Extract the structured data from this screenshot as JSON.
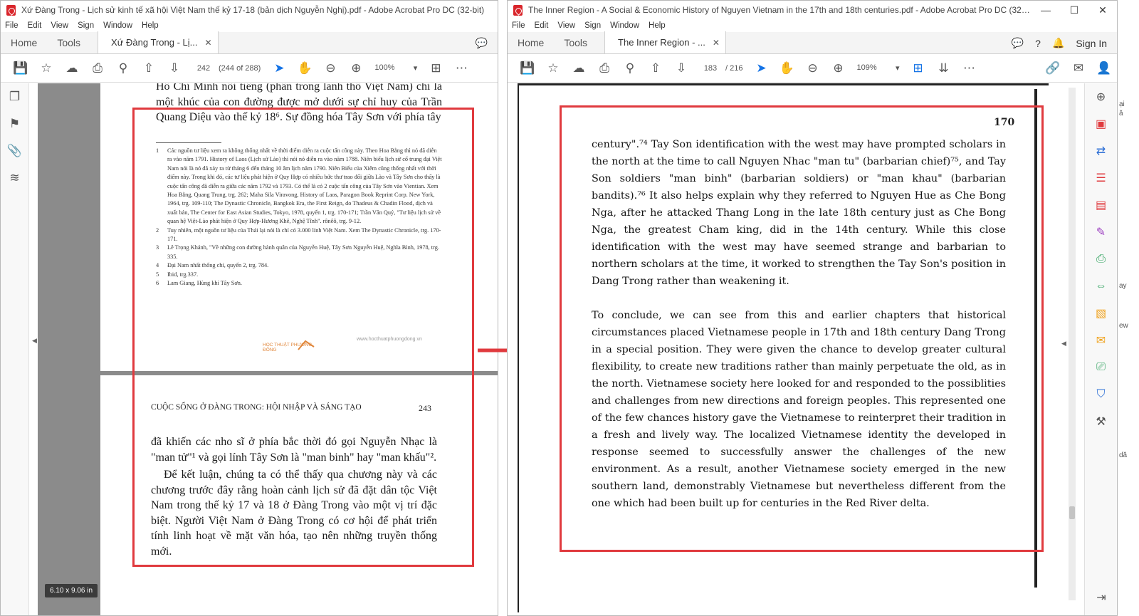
{
  "left": {
    "title": "Xứ Đàng Trong - Lịch sử kinh tế xã hội Việt Nam thế kỷ 17-18 (bản dịch Nguyễn Nghị).pdf - Adobe Acrobat Pro DC (32-bit)",
    "menu": [
      "File",
      "Edit",
      "View",
      "Sign",
      "Window",
      "Help"
    ],
    "nav_home": "Home",
    "nav_tools": "Tools",
    "tab_label": "Xứ Đàng Trong - Lị...",
    "page_current": "242",
    "page_of": "(244 of 288)",
    "zoom": "100%",
    "page_size": "6.10 x 9.06 in",
    "top_text": "Hồ Chí Minh nổi tiếng (phần trong lãnh thổ Việt Nam) chỉ là một khúc của con đường được mở dưới sự chỉ huy của Trần Quang Diệu vào thế kỷ 18⁶. Sự đồng hóa Tây Sơn với phía tây",
    "footnotes": [
      {
        "n": "1",
        "t": "Các nguồn tư liệu xem ra không thống nhất về thời điểm diễn ra cuộc tấn công này. Theo Hoa Bằng thì nó đã diễn ra vào năm 1791. History of Laos (Lịch sử Lào) thì nói nó diễn ra vào năm 1788. Niên biểu lịch sử cổ trung đại Việt Nam nói là nó đã xảy ra từ tháng 6 đến tháng 10 âm lịch năm 1790. Niên Biểu của Xiêm cũng thống nhất với thời điểm này. Trong khi đó, các tư liệu phát hiện ở Quy Hợp có nhiều bức thư trao đổi giữa Lào và Tây Sơn cho thấy là cuộc tấn công đã diễn ra giữa các năm 1792 và 1793. Có thể là có 2 cuộc tấn công của Tây Sơn vào Vientian. Xem Hoa Bằng, Quang Trung, trg. 262; Maha Sila Viravong, History of Laos, Paragon Book Reprint Corp. New York, 1964, trg. 109-110; The Dynastic Chronicle, Bangkok Era, the First Reign, do Thadeus & Chadin Flood, dịch và xuất bản, The Center for East Asian Studies, Tokyo, 1978, quyển 1, trg. 170-171; Trần Văn Quý, \"Tư liệu lịch sử về quan hệ Việt-Lào phát hiện ở Quy Hợp-Hương Khê, Nghệ Tĩnh\". rônêô, trg. 9-12."
      },
      {
        "n": "2",
        "t": "Tuy nhiên, một nguồn tư liệu của Thái lại nói là chỉ có 3.000 lính Việt Nam. Xem The Dynastic Chronicle, trg. 170-171."
      },
      {
        "n": "3",
        "t": "Lê Trọng Khánh, \"Về những con đường hành quân của Nguyễn Huệ, Tây Sơn Nguyễn Huệ, Nghĩa Bình, 1978, trg. 335."
      },
      {
        "n": "4",
        "t": "Đại Nam nhất thống chí, quyển 2, trg. 784."
      },
      {
        "n": "5",
        "t": "Ibid, trg.337."
      },
      {
        "n": "6",
        "t": "Lam Giang, Hùng khí Tây Sơn."
      }
    ],
    "website": "www.hocthuatphuongdong.vn",
    "logo": "HỌC THUẬT PHƯƠNG ĐÔNG",
    "running_head": "CUỘC SỐNG Ở ĐÀNG TRONG: HỘI NHẬP VÀ SÁNG TẠO",
    "page_number": "243",
    "para1": "đã khiến các nho sĩ ở phía bắc thời đó gọi Nguyễn Nhạc là \"man tử\"¹ và gọi lính Tây Sơn là \"man binh\" hay \"man khấu\"².",
    "para2": "Để kết luận, chúng ta có thể thấy qua chương này và các chương trước đây rằng hoàn cảnh lịch sử đã đặt dân tộc Việt Nam trong thế kỷ 17 và 18 ở Đàng Trong vào một vị trí đặc biệt. Người Việt Nam ở Đàng Trong có cơ hội để phát triển tính linh hoạt về mặt văn hóa, tạo nên những truyền thống mới."
  },
  "right": {
    "title": "The Inner Region - A Social & Economic History of Nguyen Vietnam in the 17th and 18th centuries.pdf - Adobe Acrobat Pro DC (32-bit)",
    "menu": [
      "File",
      "Edit",
      "View",
      "Sign",
      "Window",
      "Help"
    ],
    "nav_home": "Home",
    "nav_tools": "Tools",
    "tab_label": "The Inner Region - ...",
    "sign_in": "Sign In",
    "page_current": "183",
    "page_of": "/ 216",
    "zoom": "109%",
    "page_number": "170",
    "para1": "century\".⁷⁴ Tay Son identification with the west may have prompted scholars in the north at the time to call Nguyen Nhac \"man tu\" (barbarian chief)⁷⁵, and Tay Son soldiers \"man binh\" (barbarian soldiers) or \"man khau\" (barbarian bandits).⁷⁶ It also helps explain why they referred to Nguyen Hue as Che Bong Nga, after he attacked Thang Long in the late 18th century just as Che Bong Nga, the greatest Cham king, did in the 14th century. While this close identification with the west may have seemed strange and barbarian to northern scholars at the time, it worked to strengthen the Tay Son's position in Dang Trong rather than weakening it.",
    "para2": "To conclude, we can see from this and earlier chapters that historical circumstances placed Vietnamese people in 17th and 18th century Dang Trong in a special position. They were given the chance to develop greater cultural flexibility, to create new traditions rather than mainly perpetuate the old, as in the north. Vietnamese society here looked for and responded to the possiblities and challenges from new directions and foreign peoples. This represented one of the few chances history gave the Vietnamese to reinterpret their tradition in a fresh and lively way. The localized Vietnamese identity the developed in response seemed to successfully answer the challenges of the new environment. As a result, another Vietnamese society emerged in the new southern land, demonstrably Vietnamese but nevertheless different from the one which had been built up for centuries in the Red River delta."
  },
  "background_fragments": [
    "ại",
    "ă",
    "ew",
    "ay",
    "dă"
  ],
  "colors": {
    "highlight_box": "#e03a3e",
    "accent_blue": "#1473e6",
    "canvas_gray": "#8b8b8b"
  }
}
